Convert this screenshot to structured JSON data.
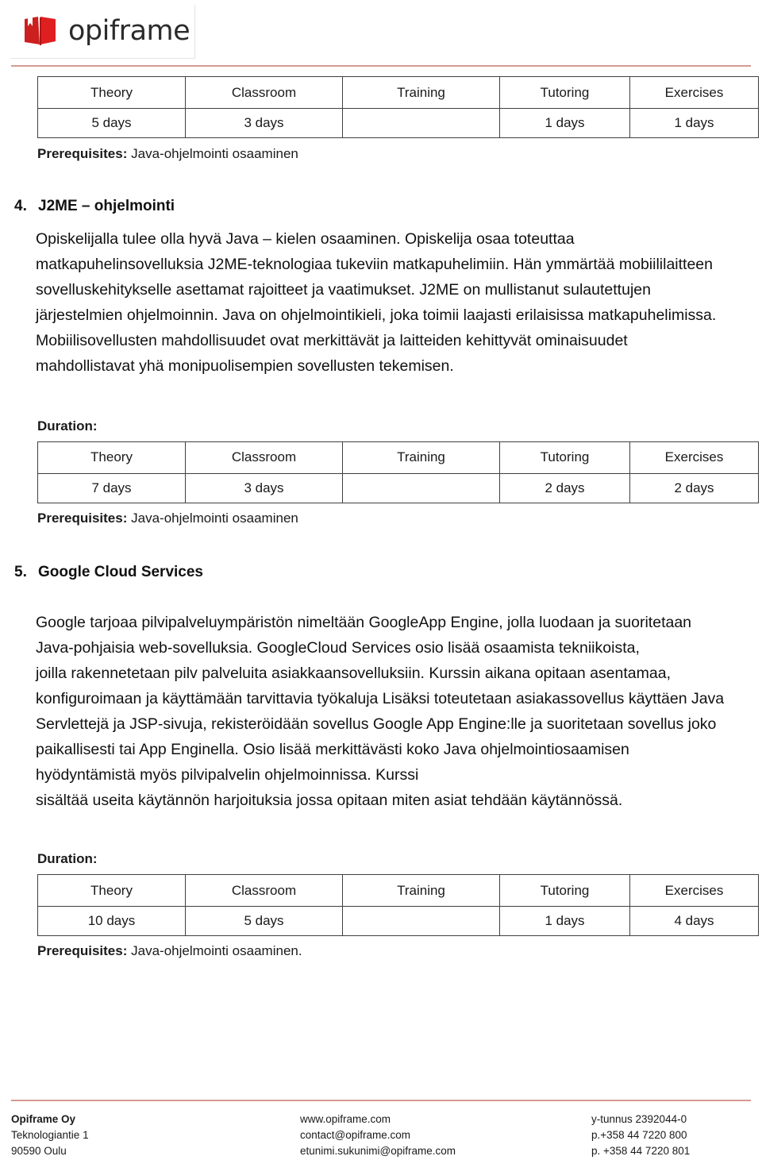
{
  "brand": {
    "logo_word": "opiframe",
    "logo_icon": "open-book-icon",
    "accent_color": "#d49a93",
    "logo_color": "#cc1f1f"
  },
  "table_headers": [
    "Theory",
    "Classroom",
    "Training",
    "Tutoring",
    "Exercises"
  ],
  "top_table": {
    "headers": [
      "Theory",
      "Classroom",
      "Training",
      "Tutoring",
      "Exercises"
    ],
    "values": [
      "5 days",
      "3 days",
      "",
      "1 days",
      "1 days"
    ]
  },
  "top_prerequisites": {
    "label": "Prerequisites:",
    "value": "Java-ohjelmointi osaaminen"
  },
  "sections": [
    {
      "number": "4.",
      "title": "J2ME – ohjelmointi",
      "body": "Opiskelijalla tulee olla hyvä Java – kielen osaaminen. Opiskelija osaa toteuttaa matkapuhelinsovelluksia J2ME-teknologiaa tukeviin matkapuhelimiin. Hän ymmärtää mobiililaitteen sovelluskehitykselle asettamat rajoitteet ja vaatimukset. J2ME on mullistanut sulautettujen järjestelmien ohjelmoinnin. Java on ohjelmointikieli, joka toimii laajasti erilaisissa matkapuhelimissa. Mobiilisovellusten mahdollisuudet ovat merkittävät ja laitteiden kehittyvät ominaisuudet mahdollistavat yhä monipuolisempien sovellusten tekemisen.",
      "duration_label": "Duration:",
      "duration": {
        "headers": [
          "Theory",
          "Classroom",
          "Training",
          "Tutoring",
          "Exercises"
        ],
        "values": [
          "7 days",
          "3 days",
          "",
          "2 days",
          "2 days"
        ]
      },
      "prerequisites": {
        "label": "Prerequisites:",
        "value": "Java-ohjelmointi osaaminen"
      }
    },
    {
      "number": "5.",
      "title": "Google Cloud Services",
      "body_lines": [
        "Google tarjoaa pilvipalveluympäristön nimeltään GoogleApp Engine, jolla luodaan ja suoritetaan Java-pohjaisia web-sovelluksia. GoogleCloud Services osio lisää osaamista tekniikoista,",
        "joilla rakennetetaan pilv palveluita asiakkaansovelluksiin. Kurssin aikana  opitaan asentamaa, konfiguroimaan ja käyttämään tarvittavia työkaluja  Lisäksi toteutetaan asiakassovellus käyttäen Java Servlettejä ja JSP-sivuja, rekisteröidään sovellus Google App Engine:lle ja  suoritetaan sovellus joko paikallisesti tai App Enginella. Osio lisää merkittävästi koko Java ohjelmointiosaamisen hyödyntämistä myös pilvipalvelin ohjelmoinnissa. Kurssi",
        "sisältää useita käytännön harjoituksia jossa opitaan miten asiat tehdään käytännössä."
      ],
      "duration_label": "Duration:",
      "duration": {
        "headers": [
          "Theory",
          "Classroom",
          "Training",
          "Tutoring",
          "Exercises"
        ],
        "values": [
          "10 days",
          "5 days",
          "",
          "1 days",
          "4 days"
        ]
      },
      "prerequisites": {
        "label": "Prerequisites:",
        "value": "Java-ohjelmointi osaaminen."
      }
    }
  ],
  "footer": {
    "col_a": [
      "Opiframe Oy",
      "Teknologiantie 1",
      "90590 Oulu"
    ],
    "col_b": [
      "www.opiframe.com",
      "contact@opiframe.com",
      "etunimi.sukunimi@opiframe.com"
    ],
    "col_c": [
      "y-tunnus 2392044-0",
      "p.+358 44 7220 800",
      "p. +358 44 7220 801"
    ]
  }
}
